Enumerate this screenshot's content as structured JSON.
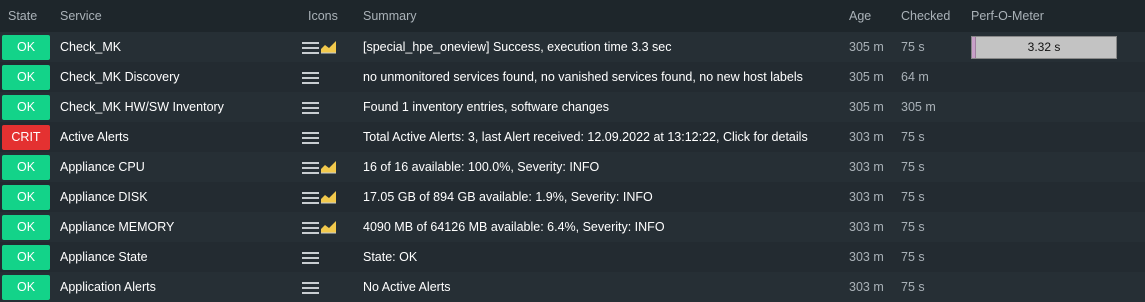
{
  "columns": {
    "state": "State",
    "service": "Service",
    "icons": "Icons",
    "summary": "Summary",
    "age": "Age",
    "checked": "Checked",
    "perf": "Perf-O-Meter"
  },
  "colors": {
    "ok": "#13d389",
    "crit": "#e43131",
    "graph_icon": "#f2c94c"
  },
  "rows": [
    {
      "state": "OK",
      "service": "Check_MK",
      "icons": [
        "menu-icon",
        "graph-icon"
      ],
      "summary": "[special_hpe_oneview] Success, execution time 3.3 sec",
      "age": "305 m",
      "checked": "75 s",
      "perf": {
        "label": "3.32 s",
        "fraction": 0.02
      }
    },
    {
      "state": "OK",
      "service": "Check_MK Discovery",
      "icons": [
        "menu-icon"
      ],
      "summary": "no unmonitored services found, no vanished services found, no new host labels",
      "age": "305 m",
      "checked": "64 m"
    },
    {
      "state": "OK",
      "service": "Check_MK HW/SW Inventory",
      "icons": [
        "menu-icon"
      ],
      "summary": "Found 1 inventory entries, software changes",
      "age": "305 m",
      "checked": "305 m"
    },
    {
      "state": "CRIT",
      "service": "Active Alerts",
      "icons": [
        "menu-icon"
      ],
      "summary": "Total Active Alerts: 3, last Alert received: 12.09.2022 at 13:12:22, Click for details",
      "age": "303 m",
      "checked": "75 s"
    },
    {
      "state": "OK",
      "service": "Appliance CPU",
      "icons": [
        "menu-icon",
        "graph-icon"
      ],
      "summary": "16 of 16 available: 100.0%, Severity: INFO",
      "age": "303 m",
      "checked": "75 s"
    },
    {
      "state": "OK",
      "service": "Appliance DISK",
      "icons": [
        "menu-icon",
        "graph-icon"
      ],
      "summary": "17.05 GB of 894 GB available: 1.9%, Severity: INFO",
      "age": "303 m",
      "checked": "75 s"
    },
    {
      "state": "OK",
      "service": "Appliance MEMORY",
      "icons": [
        "menu-icon",
        "graph-icon"
      ],
      "summary": "4090 MB of 64126 MB available: 6.4%, Severity: INFO",
      "age": "303 m",
      "checked": "75 s"
    },
    {
      "state": "OK",
      "service": "Appliance State",
      "icons": [
        "menu-icon"
      ],
      "summary": "State: OK",
      "age": "303 m",
      "checked": "75 s"
    },
    {
      "state": "OK",
      "service": "Application Alerts",
      "icons": [
        "menu-icon"
      ],
      "summary": "No Active Alerts",
      "age": "303 m",
      "checked": "75 s"
    }
  ]
}
